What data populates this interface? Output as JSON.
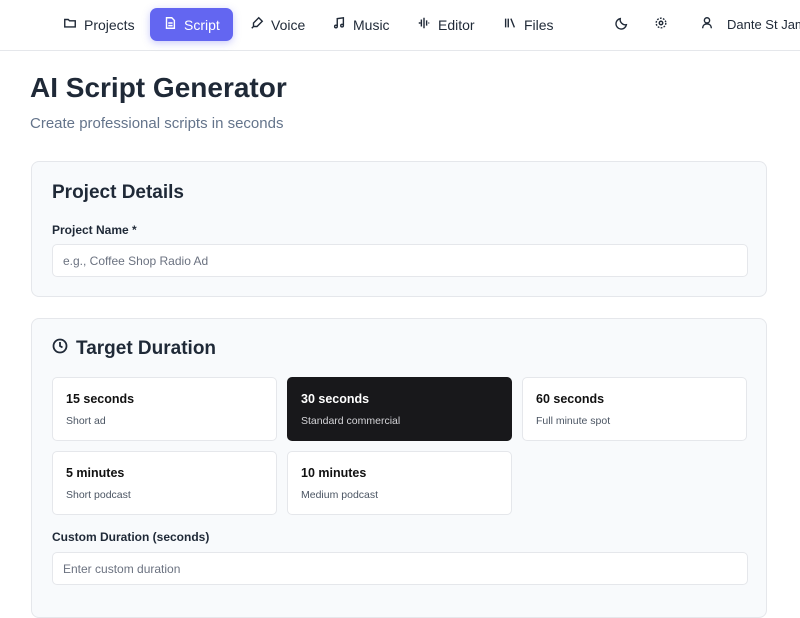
{
  "nav": {
    "items": [
      {
        "label": "Projects",
        "icon": "folder-icon"
      },
      {
        "label": "Script",
        "icon": "file-text-icon",
        "active": true
      },
      {
        "label": "Voice",
        "icon": "mic-icon"
      },
      {
        "label": "Music",
        "icon": "music-icon"
      },
      {
        "label": "Editor",
        "icon": "waveform-icon"
      },
      {
        "label": "Files",
        "icon": "library-icon"
      }
    ],
    "user_name": "Dante St Jam",
    "accent": "#6366f1"
  },
  "header": {
    "title": "AI Script Generator",
    "subtitle": "Create professional scripts in seconds"
  },
  "project": {
    "title": "Project Details",
    "name_label": "Project Name *",
    "name_placeholder": "e.g., Coffee Shop Radio Ad",
    "name_value": ""
  },
  "duration": {
    "title": "Target Duration",
    "options": [
      {
        "title": "15 seconds",
        "desc": "Short ad"
      },
      {
        "title": "30 seconds",
        "desc": "Standard commercial",
        "selected": true
      },
      {
        "title": "60 seconds",
        "desc": "Full minute spot"
      },
      {
        "title": "5 minutes",
        "desc": "Short podcast"
      },
      {
        "title": "10 minutes",
        "desc": "Medium podcast"
      }
    ],
    "custom_label": "Custom Duration (seconds)",
    "custom_placeholder": "Enter custom duration"
  }
}
